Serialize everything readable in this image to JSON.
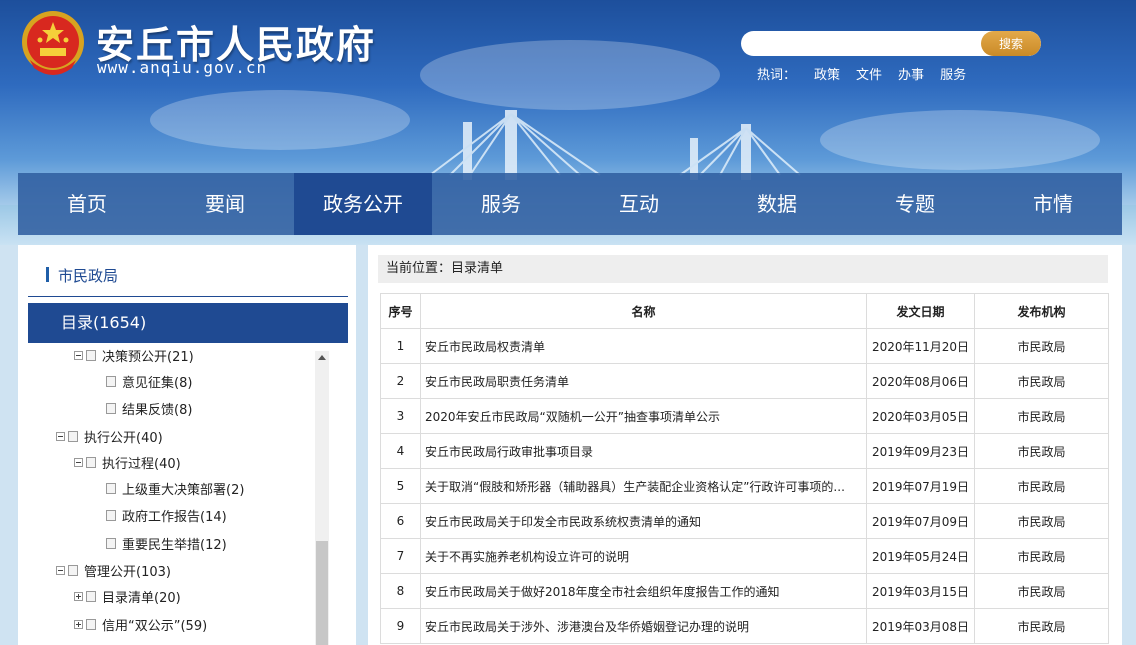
{
  "site": {
    "title": "安丘市人民政府",
    "url": "www.anqiu.gov.cn",
    "emblem_icon": "national-emblem-icon"
  },
  "search": {
    "placeholder": "",
    "button_label": "搜索",
    "hot_label": "热词：",
    "hot_words": [
      "政策",
      "文件",
      "办事",
      "服务"
    ]
  },
  "nav": {
    "items": [
      "首页",
      "要闻",
      "政务公开",
      "服务",
      "互动",
      "数据",
      "专题",
      "市情"
    ],
    "active": "政务公开"
  },
  "sidebar": {
    "department": "市民政局",
    "category": "目录(1654)",
    "tree": [
      {
        "label": "决策预公开(21)",
        "type": "folder",
        "state": "open",
        "level": 2
      },
      {
        "label": "意见征集(8)",
        "type": "leaf",
        "level": 3
      },
      {
        "label": "结果反馈(8)",
        "type": "leaf",
        "level": 3
      },
      {
        "label": "执行公开(40)",
        "type": "folder",
        "state": "open",
        "level": 1
      },
      {
        "label": "执行过程(40)",
        "type": "folder",
        "state": "open",
        "level": 2
      },
      {
        "label": "上级重大决策部署(2)",
        "type": "leaf",
        "level": 3
      },
      {
        "label": "政府工作报告(14)",
        "type": "leaf",
        "level": 3
      },
      {
        "label": "重要民生举措(12)",
        "type": "leaf",
        "level": 3
      },
      {
        "label": "管理公开(103)",
        "type": "folder",
        "state": "open",
        "level": 1
      },
      {
        "label": "目录清单(20)",
        "type": "folder",
        "state": "closed",
        "level": 2
      },
      {
        "label": "信用“双公示”(59)",
        "type": "folder",
        "state": "closed",
        "level": 2
      }
    ]
  },
  "main": {
    "breadcrumb": "当前位置：目录清单",
    "table": {
      "headers": [
        "序号",
        "名称",
        "发文日期",
        "发布机构"
      ],
      "rows": [
        [
          "1",
          "安丘市民政局权责清单",
          "2020年11月20日",
          "市民政局"
        ],
        [
          "2",
          "安丘市民政局职责任务清单",
          "2020年08月06日",
          "市民政局"
        ],
        [
          "3",
          "2020年安丘市民政局“双随机一公开”抽查事项清单公示",
          "2020年03月05日",
          "市民政局"
        ],
        [
          "4",
          "安丘市民政局行政审批事项目录",
          "2019年09月23日",
          "市民政局"
        ],
        [
          "5",
          "关于取消“假肢和矫形器（辅助器具）生产装配企业资格认定”行政许可事项的...",
          "2019年07月19日",
          "市民政局"
        ],
        [
          "6",
          "安丘市民政局关于印发全市民政系统权责清单的通知",
          "2019年07月09日",
          "市民政局"
        ],
        [
          "7",
          "关于不再实施养老机构设立许可的说明",
          "2019年05月24日",
          "市民政局"
        ],
        [
          "8",
          "安丘市民政局关于做好2018年度全市社会组织年度报告工作的通知",
          "2019年03月15日",
          "市民政局"
        ],
        [
          "9",
          "安丘市民政局关于涉外、涉港澳台及华侨婚姻登记办理的说明",
          "2019年03月08日",
          "市民政局"
        ]
      ]
    }
  }
}
